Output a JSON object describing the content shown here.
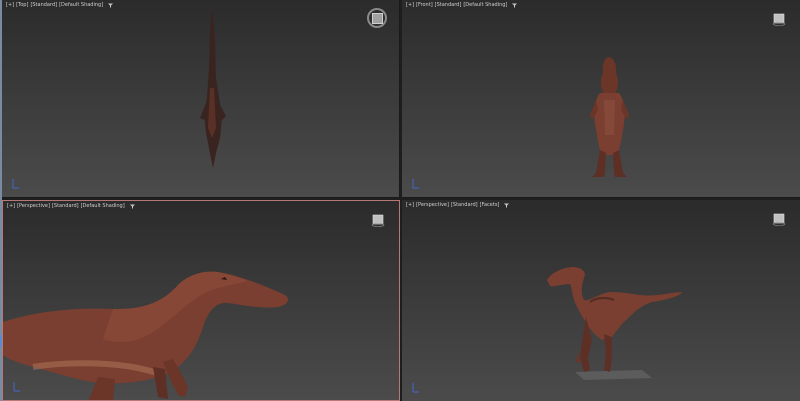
{
  "viewports": {
    "top": {
      "label_plus": "[+]",
      "label_view": "[Top]",
      "label_style": "[Standard]",
      "label_shading": "[Default Shading]"
    },
    "front": {
      "label_plus": "[+]",
      "label_view": "[Front]",
      "label_style": "[Standard]",
      "label_shading": "[Default Shading]"
    },
    "perspective": {
      "label_plus": "[+]",
      "label_view": "[Perspective]",
      "label_style": "[Standard]",
      "label_shading": "[Default Shading]",
      "active": true
    },
    "perspective2": {
      "label_plus": "[+]",
      "label_view": "[Perspective]",
      "label_style": "[Standard]",
      "label_shading": "[Facets]"
    }
  },
  "colors": {
    "active_border": "#b87878",
    "viewport_bg_top": "#2b2b2b",
    "viewport_bg_bottom": "#4b4b4b",
    "dino_skin": "#7a3f30"
  },
  "icons": {
    "filter": "filter-icon",
    "navigation": "viewcube-icon",
    "axis": "axis-tripod-icon"
  }
}
